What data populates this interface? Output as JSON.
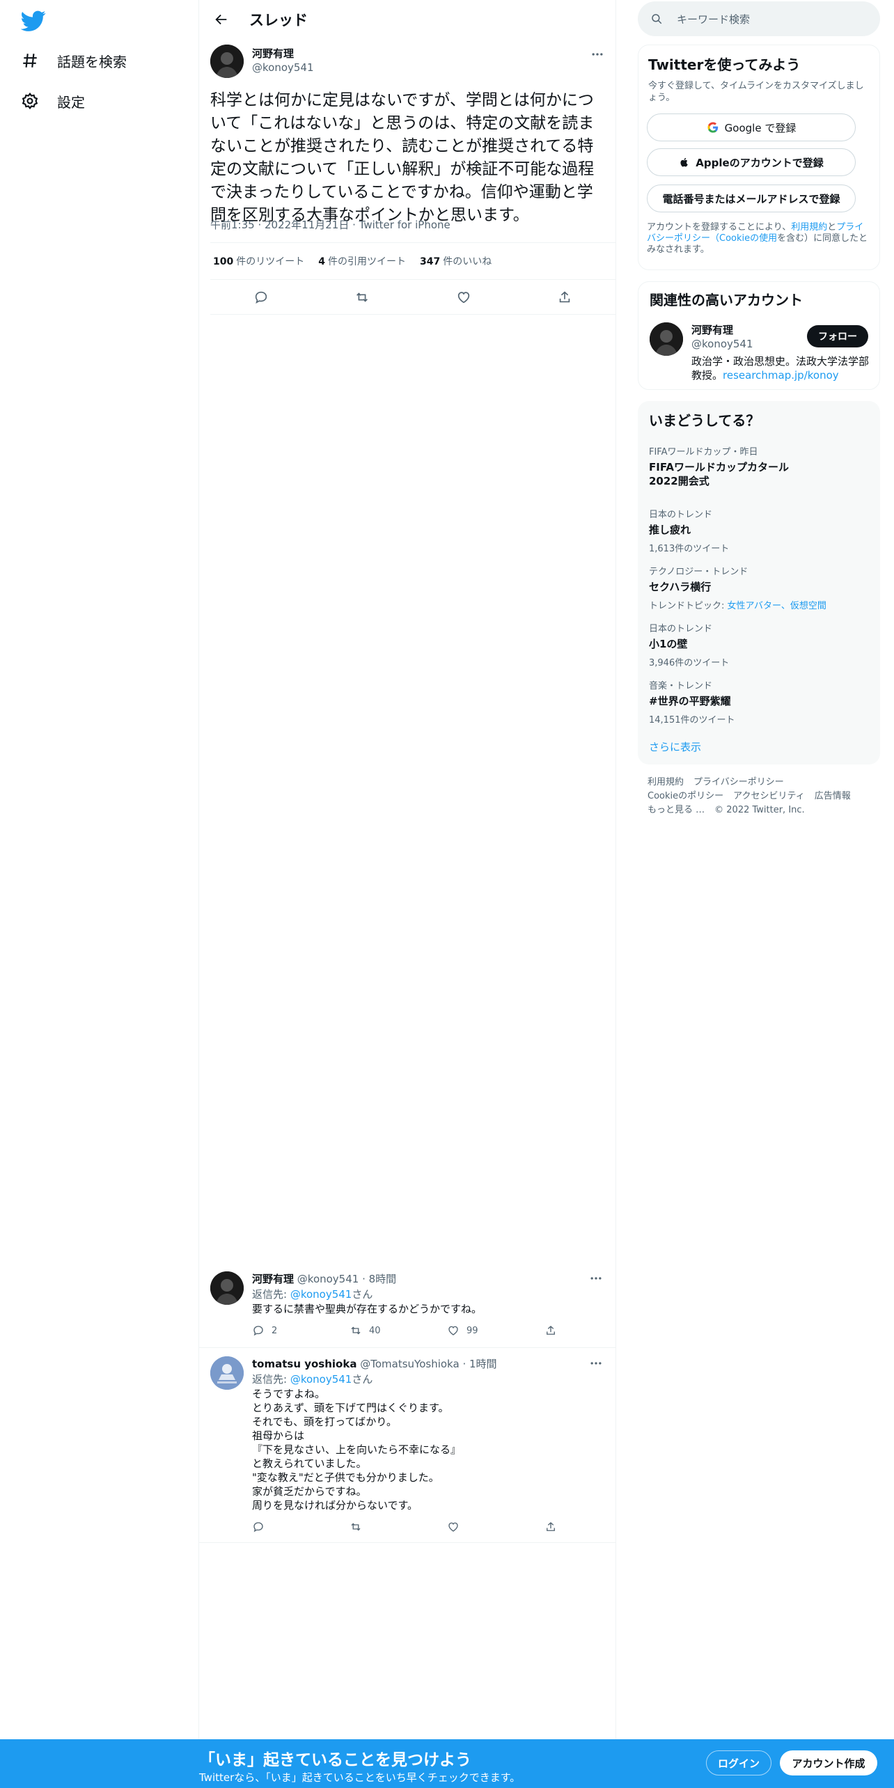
{
  "colors": {
    "accent": "#1d9bf0",
    "text": "#0f1419",
    "muted": "#536471",
    "border": "#eff3f4"
  },
  "nav": {
    "logo_icon": "twitter-bird-icon",
    "items": [
      {
        "label": "話題を検索",
        "icon": "hashtag-icon"
      },
      {
        "label": "設定",
        "icon": "gear-icon"
      }
    ]
  },
  "header": {
    "title": "スレッド"
  },
  "tweet": {
    "name": "河野有理",
    "handle": "@konoy541",
    "text": "科学とは何かに定見はないですが、学問とは何かについて「これはないな」と思うのは、特定の文献を読まないことが推奨されたり、読むことが推奨されてる特定の文献について「正しい解釈」が検証不可能な過程で決まったりしていることですかね。信仰や運動と学問を区別する大事なポイントかと思います。",
    "time": "午前1:35",
    "date": "2022年11月21日",
    "source": "Twitter for iPhone",
    "stats": [
      {
        "count": "100",
        "label": "件のリツイート"
      },
      {
        "count": "4",
        "label": "件の引用ツイート"
      },
      {
        "count": "347",
        "label": "件のいいね"
      }
    ]
  },
  "replies": [
    {
      "name": "河野有理",
      "handle": "@konoy541",
      "time": "8時間",
      "reply_prefix": "返信先: ",
      "reply_to": "@konoy541",
      "reply_suffix": "さん",
      "text": "要するに禁書や聖典が存在するかどうかですね。",
      "counts": {
        "reply": "2",
        "retweet": "40",
        "like": "99"
      }
    },
    {
      "name": "tomatsu yoshioka",
      "handle": "@TomatsuYoshioka",
      "time": "1時間",
      "reply_prefix": "返信先: ",
      "reply_to": "@konoy541",
      "reply_suffix": "さん",
      "text": "そうですよね。\nとりあえず、頭を下げて門はくぐります。\nそれでも、頭を打ってばかり。\n祖母からは\n『下を見なさい、上を向いたら不幸になる』\nと教えられていました。\n\"変な教え\"だと子供でも分かりました。\n家が貧乏だからですね。\n周りを見なければ分からないです。",
      "counts": {
        "reply": "",
        "retweet": "",
        "like": ""
      }
    }
  ],
  "search": {
    "placeholder": "キーワード検索"
  },
  "signup": {
    "title": "Twitterを使ってみよう",
    "subtitle": "今すぐ登録して、タイムラインをカスタマイズしましょう。",
    "google": "Google で登録",
    "apple": "Appleのアカウントで登録",
    "phone": "電話番号またはメールアドレスで登録",
    "legal_1": "アカウントを登録することにより、",
    "legal_terms": "利用規約",
    "legal_2": "と",
    "legal_privacy": "プライバシーポリシー（Cookieの使用",
    "legal_3": "を含む）に同意したとみなされます。"
  },
  "related": {
    "title": "関連性の高いアカウント",
    "name": "河野有理",
    "handle": "@konoy541",
    "follow": "フォロー",
    "bio": "政治学・政治思想史。法政大学法学部教授。",
    "bio_link": "researchmap.jp/konoy"
  },
  "trends": {
    "title": "いまどうしてる？",
    "items": [
      {
        "context": "FIFAワールドカップ・昨日",
        "name": "FIFAワールドカップカタール2022開会式",
        "count": ""
      },
      {
        "context": "日本のトレンド",
        "name": "推し疲れ",
        "count": "1,613件のツイート"
      },
      {
        "context": "テクノロジー・トレンド",
        "name": "セクハラ横行",
        "count": "トレンドトピック: ",
        "topics": "女性アバター、仮想空間"
      },
      {
        "context": "日本のトレンド",
        "name": "小1の壁",
        "count": "3,946件のツイート"
      },
      {
        "context": "音楽・トレンド",
        "name": "#世界の平野紫耀",
        "count": "14,151件のツイート"
      }
    ],
    "more": "さらに表示"
  },
  "footer": {
    "terms": "利用規約",
    "privacy": "プライバシーポリシー",
    "cookies": "Cookieのポリシー",
    "accessibility": "アクセシビリティ",
    "ads": "広告情報",
    "more": "もっと見る …",
    "copyright": "© 2022 Twitter, Inc."
  },
  "bottombar": {
    "title": "「いま」起きていることを見つけよう",
    "subtitle": "Twitterなら、「いま」起きていることをいち早くチェックできます。",
    "login": "ログイン",
    "signup": "アカウント作成"
  }
}
